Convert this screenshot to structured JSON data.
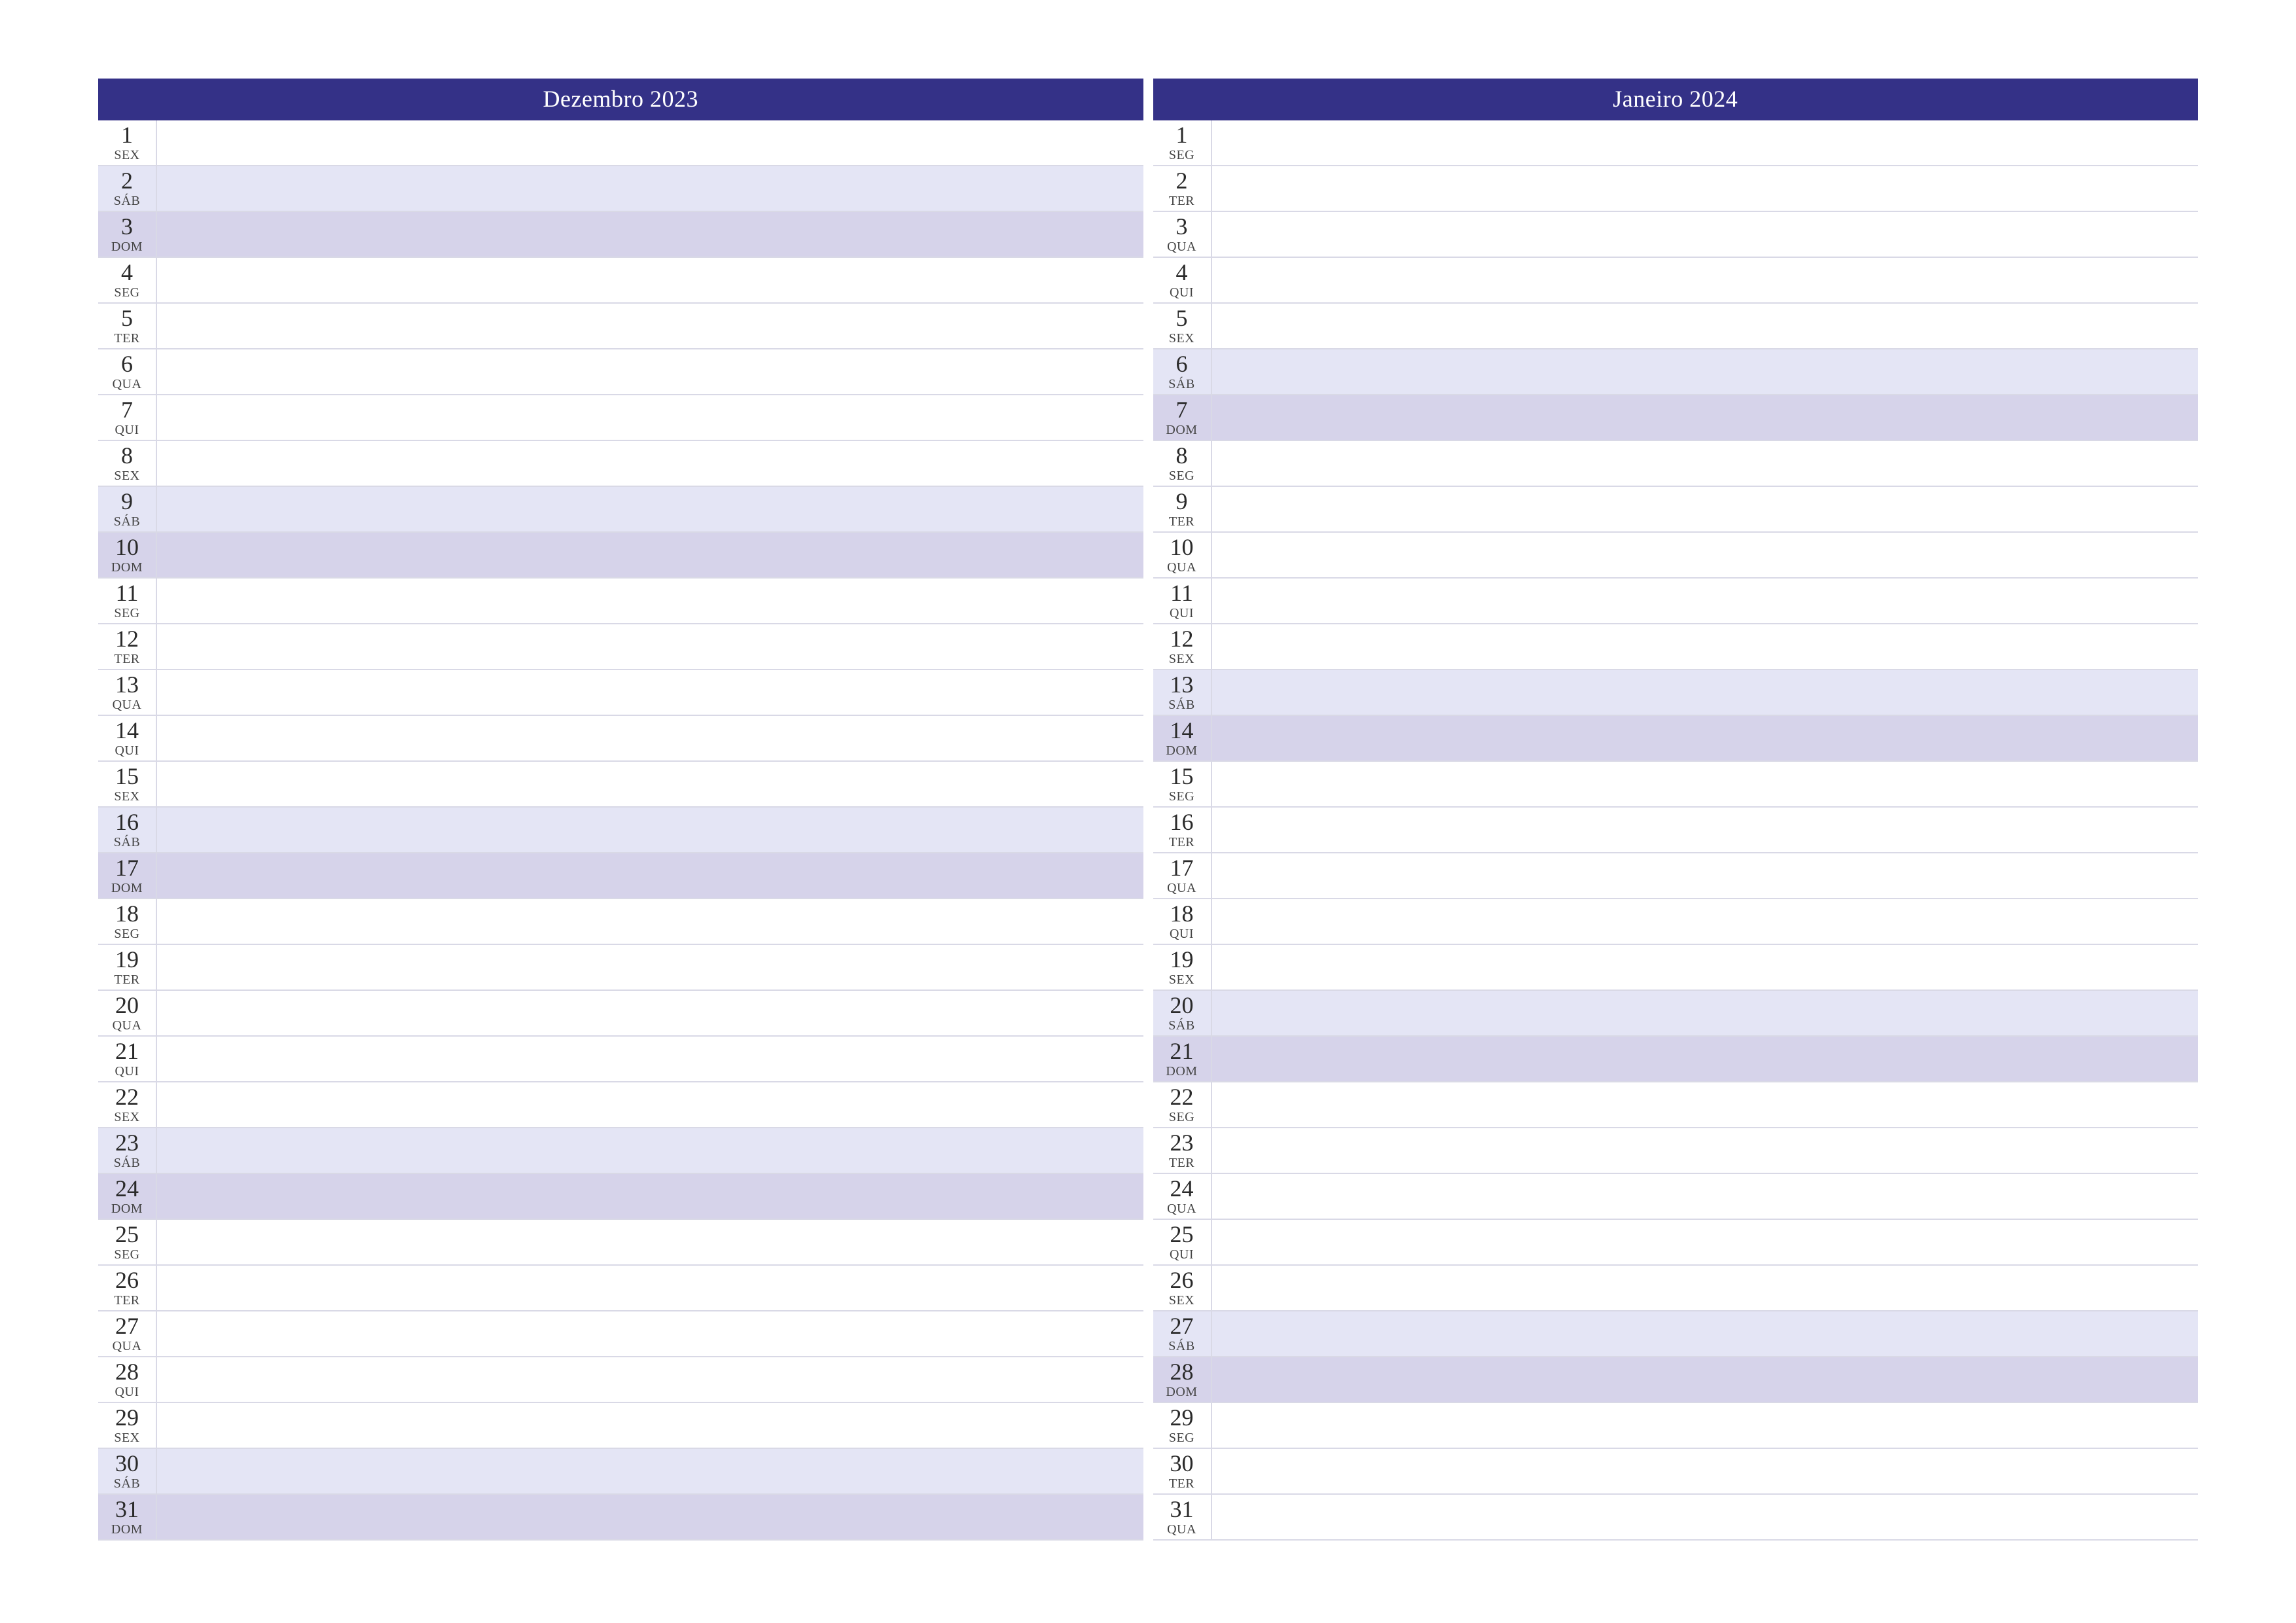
{
  "colors": {
    "header_bg": "#343187",
    "header_fg": "#ffffff",
    "sat_bg": "#e4e5f5",
    "sun_bg": "#d6d3ea",
    "row_border": "#d9d9e6"
  },
  "months": [
    {
      "title": "Dezembro 2023",
      "days": [
        {
          "num": "1",
          "abbr": "SEX",
          "type": "weekday"
        },
        {
          "num": "2",
          "abbr": "SÁB",
          "type": "sat"
        },
        {
          "num": "3",
          "abbr": "DOM",
          "type": "sun"
        },
        {
          "num": "4",
          "abbr": "SEG",
          "type": "weekday"
        },
        {
          "num": "5",
          "abbr": "TER",
          "type": "weekday"
        },
        {
          "num": "6",
          "abbr": "QUA",
          "type": "weekday"
        },
        {
          "num": "7",
          "abbr": "QUI",
          "type": "weekday"
        },
        {
          "num": "8",
          "abbr": "SEX",
          "type": "weekday"
        },
        {
          "num": "9",
          "abbr": "SÁB",
          "type": "sat"
        },
        {
          "num": "10",
          "abbr": "DOM",
          "type": "sun"
        },
        {
          "num": "11",
          "abbr": "SEG",
          "type": "weekday"
        },
        {
          "num": "12",
          "abbr": "TER",
          "type": "weekday"
        },
        {
          "num": "13",
          "abbr": "QUA",
          "type": "weekday"
        },
        {
          "num": "14",
          "abbr": "QUI",
          "type": "weekday"
        },
        {
          "num": "15",
          "abbr": "SEX",
          "type": "weekday"
        },
        {
          "num": "16",
          "abbr": "SÁB",
          "type": "sat"
        },
        {
          "num": "17",
          "abbr": "DOM",
          "type": "sun"
        },
        {
          "num": "18",
          "abbr": "SEG",
          "type": "weekday"
        },
        {
          "num": "19",
          "abbr": "TER",
          "type": "weekday"
        },
        {
          "num": "20",
          "abbr": "QUA",
          "type": "weekday"
        },
        {
          "num": "21",
          "abbr": "QUI",
          "type": "weekday"
        },
        {
          "num": "22",
          "abbr": "SEX",
          "type": "weekday"
        },
        {
          "num": "23",
          "abbr": "SÁB",
          "type": "sat"
        },
        {
          "num": "24",
          "abbr": "DOM",
          "type": "sun"
        },
        {
          "num": "25",
          "abbr": "SEG",
          "type": "weekday"
        },
        {
          "num": "26",
          "abbr": "TER",
          "type": "weekday"
        },
        {
          "num": "27",
          "abbr": "QUA",
          "type": "weekday"
        },
        {
          "num": "28",
          "abbr": "QUI",
          "type": "weekday"
        },
        {
          "num": "29",
          "abbr": "SEX",
          "type": "weekday"
        },
        {
          "num": "30",
          "abbr": "SÁB",
          "type": "sat"
        },
        {
          "num": "31",
          "abbr": "DOM",
          "type": "sun"
        }
      ]
    },
    {
      "title": "Janeiro 2024",
      "days": [
        {
          "num": "1",
          "abbr": "SEG",
          "type": "weekday"
        },
        {
          "num": "2",
          "abbr": "TER",
          "type": "weekday"
        },
        {
          "num": "3",
          "abbr": "QUA",
          "type": "weekday"
        },
        {
          "num": "4",
          "abbr": "QUI",
          "type": "weekday"
        },
        {
          "num": "5",
          "abbr": "SEX",
          "type": "weekday"
        },
        {
          "num": "6",
          "abbr": "SÁB",
          "type": "sat"
        },
        {
          "num": "7",
          "abbr": "DOM",
          "type": "sun"
        },
        {
          "num": "8",
          "abbr": "SEG",
          "type": "weekday"
        },
        {
          "num": "9",
          "abbr": "TER",
          "type": "weekday"
        },
        {
          "num": "10",
          "abbr": "QUA",
          "type": "weekday"
        },
        {
          "num": "11",
          "abbr": "QUI",
          "type": "weekday"
        },
        {
          "num": "12",
          "abbr": "SEX",
          "type": "weekday"
        },
        {
          "num": "13",
          "abbr": "SÁB",
          "type": "sat"
        },
        {
          "num": "14",
          "abbr": "DOM",
          "type": "sun"
        },
        {
          "num": "15",
          "abbr": "SEG",
          "type": "weekday"
        },
        {
          "num": "16",
          "abbr": "TER",
          "type": "weekday"
        },
        {
          "num": "17",
          "abbr": "QUA",
          "type": "weekday"
        },
        {
          "num": "18",
          "abbr": "QUI",
          "type": "weekday"
        },
        {
          "num": "19",
          "abbr": "SEX",
          "type": "weekday"
        },
        {
          "num": "20",
          "abbr": "SÁB",
          "type": "sat"
        },
        {
          "num": "21",
          "abbr": "DOM",
          "type": "sun"
        },
        {
          "num": "22",
          "abbr": "SEG",
          "type": "weekday"
        },
        {
          "num": "23",
          "abbr": "TER",
          "type": "weekday"
        },
        {
          "num": "24",
          "abbr": "QUA",
          "type": "weekday"
        },
        {
          "num": "25",
          "abbr": "QUI",
          "type": "weekday"
        },
        {
          "num": "26",
          "abbr": "SEX",
          "type": "weekday"
        },
        {
          "num": "27",
          "abbr": "SÁB",
          "type": "sat"
        },
        {
          "num": "28",
          "abbr": "DOM",
          "type": "sun"
        },
        {
          "num": "29",
          "abbr": "SEG",
          "type": "weekday"
        },
        {
          "num": "30",
          "abbr": "TER",
          "type": "weekday"
        },
        {
          "num": "31",
          "abbr": "QUA",
          "type": "weekday"
        }
      ]
    }
  ]
}
